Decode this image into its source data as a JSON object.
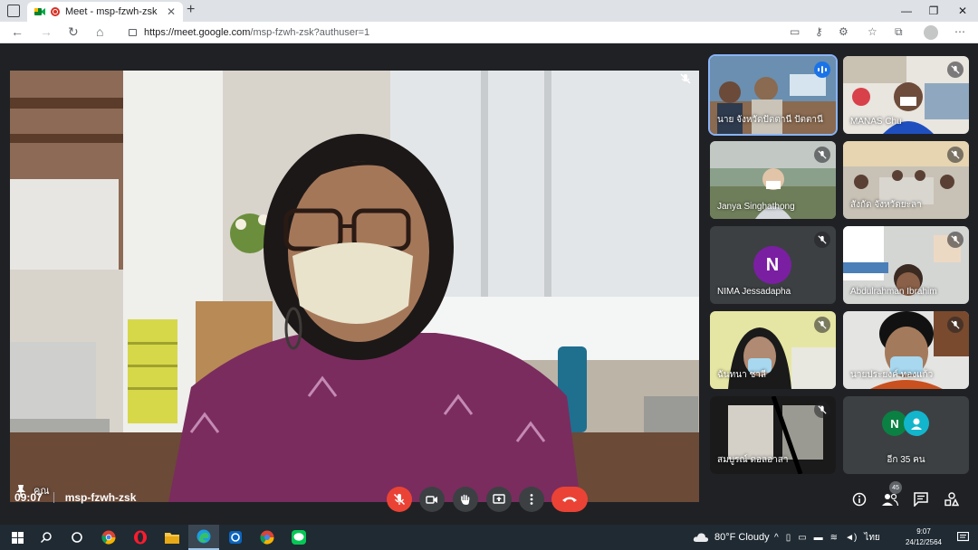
{
  "browser": {
    "tab_title": "Meet - msp-fzwh-zsk",
    "url_host": "https://meet.google.com",
    "url_path": "/msp-fzwh-zsk?authuser=1"
  },
  "meeting": {
    "time": "09:07",
    "code": "msp-fzwh-zsk",
    "self_label": "คุณ",
    "participant_count": "45",
    "more_label": "อีก 35 คน"
  },
  "participants": [
    {
      "name": "นาย จังหวัดปัตตานี ปัตตานี",
      "speaking": true
    },
    {
      "name": "MANAS Chu",
      "muted": true
    },
    {
      "name": "Janya Singhathong",
      "muted": true
    },
    {
      "name": "สังกัด จังหวัดยะลา",
      "muted": true
    },
    {
      "name": "NIMA Jessadapha",
      "muted": true,
      "avatar": "N",
      "avatar_color": "#7b1fa2"
    },
    {
      "name": "Abdulrahman Ibrahim",
      "muted": true
    },
    {
      "name": "ฉันทนา ชาลี",
      "muted": true
    },
    {
      "name": "นายประยงค์ ทองแก้ว",
      "muted": true
    },
    {
      "name": "สมบูรณ์ ดอลอาสา",
      "muted": true
    }
  ],
  "more_avatars": [
    {
      "letter": "N",
      "color": "#0b8043"
    },
    {
      "letter": "",
      "color": "#12b5cb"
    }
  ],
  "icons": {
    "mic": "mic-off-icon",
    "camera": "camera-icon",
    "hand": "raise-hand-icon",
    "present": "present-screen-icon",
    "more": "more-options-icon",
    "end": "end-call-icon",
    "info": "info-icon",
    "people": "people-icon",
    "chat": "chat-icon",
    "activities": "activities-icon"
  },
  "colors": {
    "stage": "#202124",
    "end_call": "#ea4335",
    "accent": "#8ab4f8"
  },
  "taskbar": {
    "weather": "80°F  Cloudy",
    "language": "ไทย",
    "time": "9:07",
    "date": "24/12/2564"
  }
}
